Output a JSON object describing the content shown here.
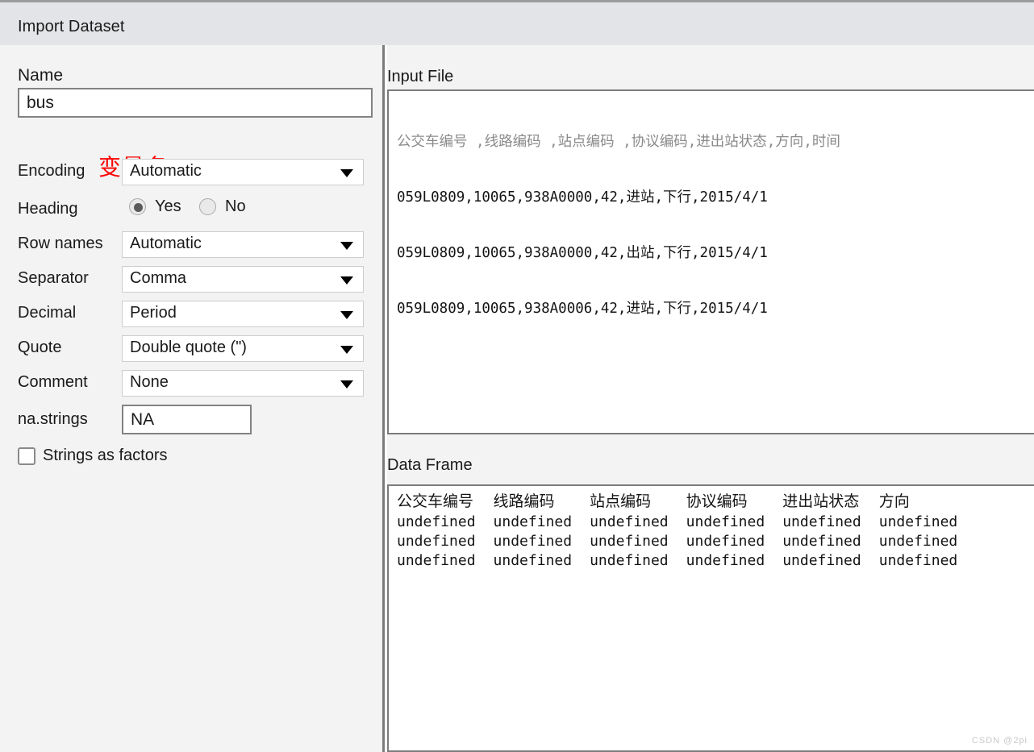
{
  "window": {
    "title": "Import Dataset"
  },
  "options": {
    "name_label": "Name",
    "name_value": "bus",
    "name_placeholder": "",
    "annotation": "变量名",
    "encoding_label": "Encoding",
    "encoding_value": "Automatic",
    "heading_label": "Heading",
    "heading_yes": "Yes",
    "heading_no": "No",
    "heading_selected": "Yes",
    "rownames_label": "Row names",
    "rownames_value": "Automatic",
    "separator_label": "Separator",
    "separator_value": "Comma",
    "decimal_label": "Decimal",
    "decimal_value": "Period",
    "quote_label": "Quote",
    "quote_value": "Double quote (\")",
    "comment_label": "Comment",
    "comment_value": "None",
    "nastrings_label": "na.strings",
    "nastrings_value": "NA",
    "strings_as_factors_label": "Strings as factors",
    "strings_as_factors_checked": false
  },
  "input_file": {
    "title": "Input File",
    "header_line": "公交车编号 ,线路编码 ,站点编码 ,协议编码,进出站状态,方向,时间",
    "lines": [
      "059L0809,10065,938A0000,42,进站,下行,2015/4/1",
      "059L0809,10065,938A0000,42,出站,下行,2015/4/1",
      "059L0809,10065,938A0006,42,进站,下行,2015/4/1"
    ]
  },
  "data_frame": {
    "title": "Data Frame",
    "columns": [
      "公交车编号",
      "线路编码",
      "站点编码",
      "协议编码",
      "进出站状态",
      "方向"
    ],
    "rows": [
      [
        "undefined",
        "undefined",
        "undefined",
        "undefined",
        "undefined",
        "undefined"
      ],
      [
        "undefined",
        "undefined",
        "undefined",
        "undefined",
        "undefined",
        "undefined"
      ],
      [
        "undefined",
        "undefined",
        "undefined",
        "undefined",
        "undefined",
        "undefined"
      ]
    ]
  },
  "watermark": "CSDN @2pi",
  "colors": {
    "titlebar": "#e2e4e7",
    "panel": "#f2f3f2",
    "annotation": "#fd0000",
    "border": "#7c7c7c"
  }
}
